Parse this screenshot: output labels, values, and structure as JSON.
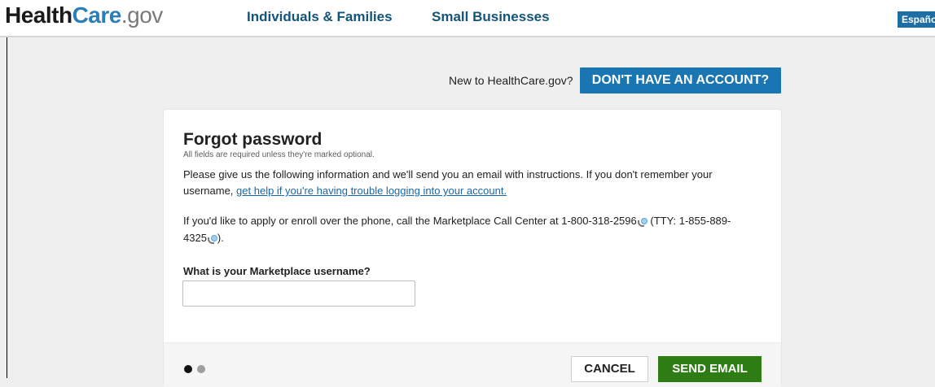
{
  "header": {
    "logo": {
      "part1": "Health",
      "part2": "Care",
      "part3": ".gov"
    },
    "nav": [
      "Individuals & Families",
      "Small Businesses"
    ],
    "language_button": "Español"
  },
  "account_prompt": {
    "text": "New to HealthCare.gov?",
    "button": "DON'T HAVE AN ACCOUNT?"
  },
  "form": {
    "title": "Forgot password",
    "required_note": "All fields are required unless they're marked optional.",
    "para1_text": "Please give us the following information and we'll send you an email with instructions. If you don't remember your username, ",
    "para1_link": "get help if you're having trouble logging into your account.",
    "para2_start": "If you'd like to apply or enroll over the phone, call the Marketplace Call Center at 1-800-318-2596",
    "para2_mid": " (TTY: 1-855-889-4325",
    "para2_end": ").",
    "username_label": "What is your Marketplace username?",
    "username_value": "",
    "cancel_button": "CANCEL",
    "send_button": "SEND EMAIL",
    "steps": {
      "current": 1,
      "total": 2
    }
  },
  "colors": {
    "brand_blue": "#1976b2",
    "send_green": "#2e7d14",
    "nav_blue": "#135479"
  },
  "icons": [
    "phone-icon"
  ]
}
